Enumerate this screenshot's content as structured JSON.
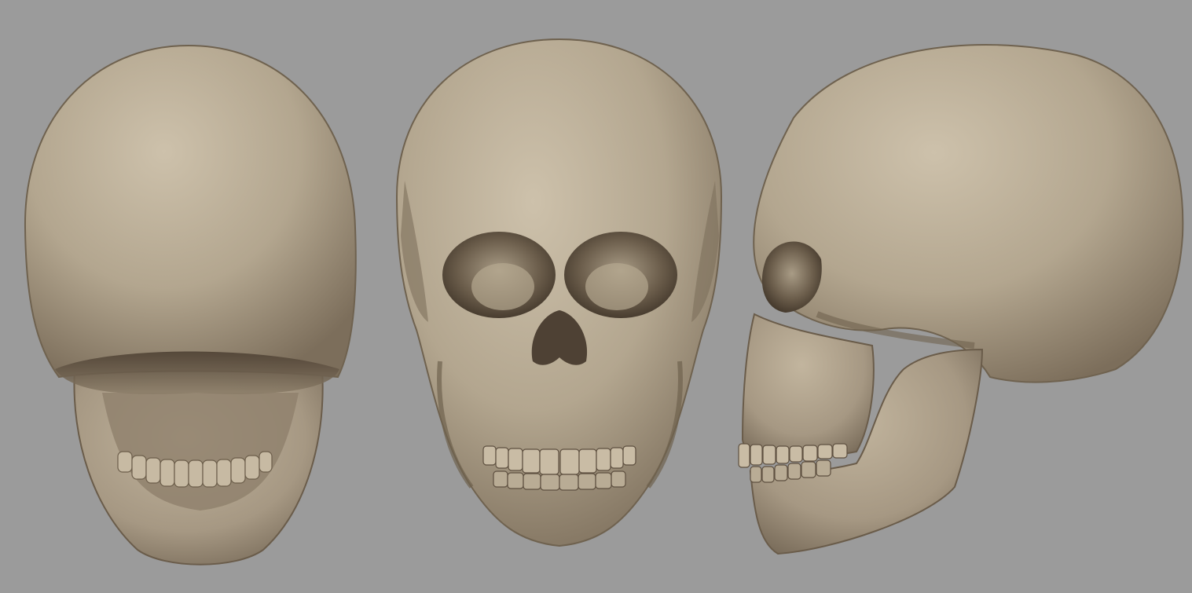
{
  "scene": {
    "background_color": "#9b9b9b",
    "bone_base_color": "#b3a690",
    "bone_light_color": "#cbbfa9",
    "bone_shadow_color": "#5a4c3d",
    "views": [
      {
        "id": "back",
        "name": "skull-back-view"
      },
      {
        "id": "front",
        "name": "skull-front-view"
      },
      {
        "id": "side",
        "name": "skull-side-view"
      }
    ]
  }
}
